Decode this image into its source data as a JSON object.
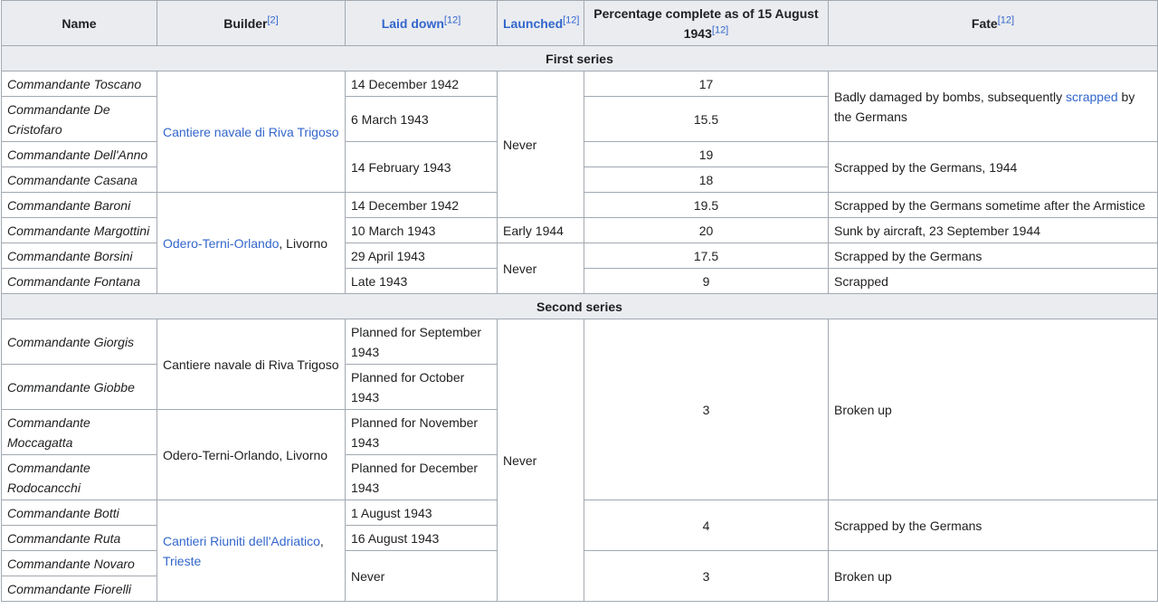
{
  "headers": {
    "name": "Name",
    "builder": "Builder",
    "builder_ref": "[2]",
    "laid_down": "Laid down",
    "laid_down_ref": "[12]",
    "launched": "Launched",
    "launched_ref": "[12]",
    "percentage": "Percentage complete as of 15 August 1943",
    "percentage_ref": "[12]",
    "fate": "Fate",
    "fate_ref": "[12]"
  },
  "sections": {
    "first": "First series",
    "second": "Second series"
  },
  "names": [
    "Commandante Toscano",
    "Commandante De Cristofaro",
    "Commandante Dell'Anno",
    "Commandante Casana",
    "Commandante Baroni",
    "Commandante Margottini",
    "Commandante Borsini",
    "Commandante Fontana",
    "Commandante Giorgis",
    "Commandante Giobbe",
    "Commandante Moccagatta",
    "Commandante Rodocancchi",
    "Commandante Botti",
    "Commandante Ruta",
    "Commandante Novaro",
    "Commandante Fiorelli"
  ],
  "builders": {
    "riva_trigoso_link": "Cantiere navale di Riva Trigoso",
    "odero_link": "Odero-Terni-Orlando",
    "odero_suffix": ", Livorno",
    "riva_trigoso_plain": "Cantiere navale di Riva Trigoso",
    "odero_plain": "Odero-Terni-Orlando, Livorno",
    "adriatico_link": "Cantieri Riuniti dell'Adriatico",
    "adriatico_comma": ",",
    "trieste_link": "Trieste"
  },
  "laid_down": [
    "14 December 1942",
    "6 March 1943",
    "14 February 1943",
    "14 December 1942",
    "10 March 1943",
    "29 April 1943",
    "Late 1943",
    "Planned for September 1943",
    "Planned for October 1943",
    "Planned for November 1943",
    "Planned for December 1943",
    "1 August 1943",
    "16 August 1943",
    "Never"
  ],
  "launched": [
    "Never",
    "Early 1944",
    "Never",
    "Never"
  ],
  "percentage": [
    "17",
    "15.5",
    "19",
    "18",
    "19.5",
    "20",
    "17.5",
    "9",
    "3",
    "4",
    "3"
  ],
  "fate": {
    "badly_damaged_pre": "Badly damaged by bombs, subsequently ",
    "badly_damaged_link": "scrapped",
    "badly_damaged_post": " by the Germans",
    "scrapped_1944": "Scrapped by the Germans, 1944",
    "after_armistice": "Scrapped by the Germans sometime after the Armistice",
    "sunk": "Sunk by aircraft, 23 September 1944",
    "scrapped_germans": "Scrapped by the Germans",
    "scrapped": "Scrapped",
    "broken_up": "Broken up",
    "scrapped_germans_2": "Scrapped by the Germans",
    "broken_up_2": "Broken up"
  },
  "colors": {
    "header_bg": "#eaecf0",
    "border": "#a2a9b1",
    "link": "#3366cc",
    "text": "#202122"
  }
}
